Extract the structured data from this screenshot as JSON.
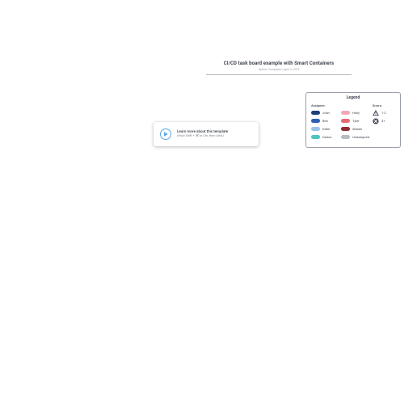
{
  "title": {
    "main": "CI/CD task board example with Smart Containers",
    "sub": "System Templates  |  April 2, 2025"
  },
  "callout": {
    "line1": "Learn more about this template",
    "line2": "(Hold Shift + ⌘ or Ctrl, then click)"
  },
  "legend": {
    "title": "Legend",
    "assignee_heading": "Assignee:",
    "errors_heading": "Errors:",
    "assignees_col1": [
      {
        "name": "Josh",
        "color": "#1d3e78"
      },
      {
        "name": "Ben",
        "color": "#2f5fb3"
      },
      {
        "name": "Katie",
        "color": "#9cc2ea"
      },
      {
        "name": "Darius",
        "color": "#4ec3bf"
      }
    ],
    "assignees_col2": [
      {
        "name": "Holly",
        "color": "#f4a9b7"
      },
      {
        "name": "Tyler",
        "color": "#e46b75"
      },
      {
        "name": "Shawn",
        "color": "#8f2d34"
      },
      {
        "name": "Unassigned",
        "color": "#b7bcc3"
      }
    ],
    "errors": [
      {
        "icon": "warning",
        "label": "1-2"
      },
      {
        "icon": "stop",
        "label": "3+"
      }
    ]
  }
}
